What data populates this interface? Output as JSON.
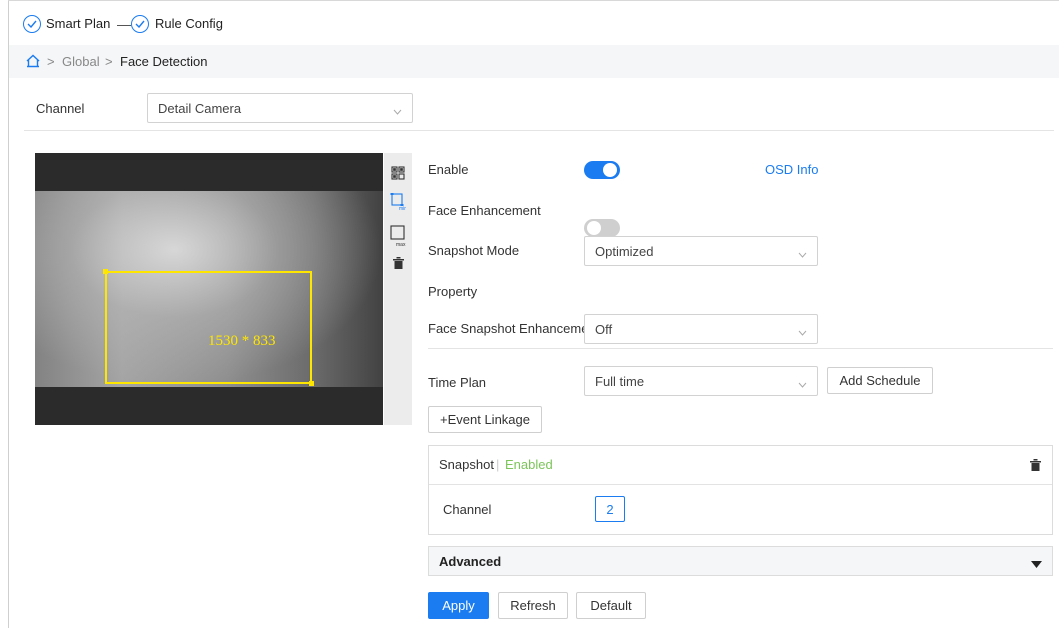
{
  "steps": [
    {
      "label": "Smart Plan"
    },
    {
      "label": "Rule Config"
    }
  ],
  "breadcrumb": {
    "items": [
      "Global",
      "Face Detection"
    ],
    "separator": ">"
  },
  "channel_row": {
    "label": "Channel",
    "value": "Detail Camera"
  },
  "video": {
    "roi_label": "1530 * 833"
  },
  "tools": [
    "qr-grid-icon",
    "min-rect-icon",
    "max-rect-icon",
    "trash-icon"
  ],
  "settings": {
    "enable": {
      "label": "Enable",
      "on": true
    },
    "osd_info": "OSD Info",
    "face_enhancement": {
      "label": "Face Enhancement",
      "on": false
    },
    "snapshot_mode": {
      "label": "Snapshot Mode",
      "value": "Optimized"
    },
    "property": {
      "label": "Property",
      "on": true
    },
    "face_snapshot_enhancement": {
      "label": "Face Snapshot Enhancement",
      "value": "Off"
    },
    "time_plan": {
      "label": "Time Plan",
      "value": "Full time"
    },
    "add_schedule": "Add Schedule",
    "event_linkage": "+Event Linkage"
  },
  "snapshot_card": {
    "title": "Snapshot",
    "separator": "|",
    "status": "Enabled",
    "channel_label": "Channel",
    "channel_value": "2"
  },
  "advanced": {
    "label": "Advanced"
  },
  "footer": {
    "apply": "Apply",
    "refresh": "Refresh",
    "default": "Default"
  },
  "colors": {
    "accent": "#1a7cf0",
    "enabled": "#7cc55a",
    "roi": "#ffe600"
  }
}
